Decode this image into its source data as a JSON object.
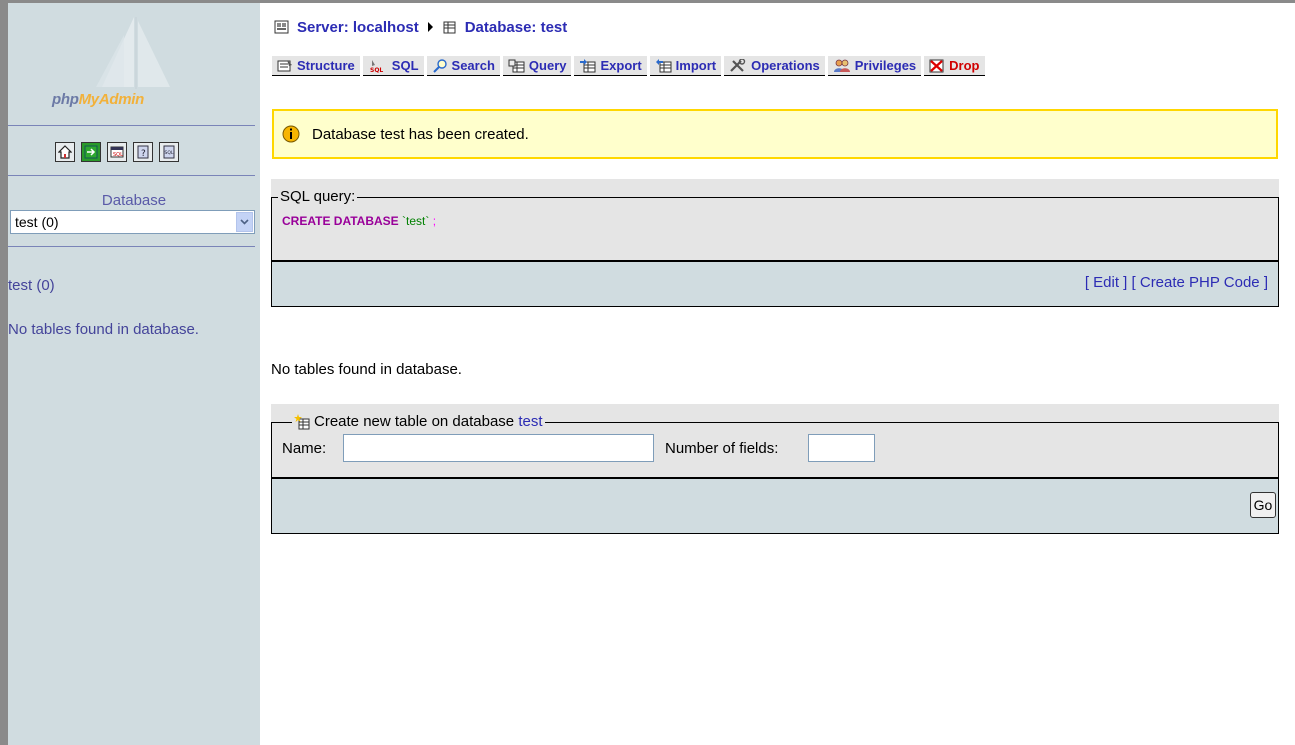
{
  "sidebar": {
    "logo_php": "php",
    "logo_myadmin": "MyAdmin",
    "icons": [
      "home-icon",
      "exit-icon",
      "query-window-icon",
      "documentation-icon",
      "sql-docs-icon"
    ],
    "database_label": "Database",
    "database_selected": "test (0)",
    "db_link": "test (0)",
    "no_tables": "No tables found in database."
  },
  "breadcrumb": {
    "server": "Server: localhost",
    "database": "Database: test"
  },
  "tabs": [
    {
      "label": "Structure",
      "icon": "structure-icon"
    },
    {
      "label": "SQL",
      "icon": "sql-icon"
    },
    {
      "label": "Search",
      "icon": "search-icon"
    },
    {
      "label": "Query",
      "icon": "query-icon"
    },
    {
      "label": "Export",
      "icon": "export-icon"
    },
    {
      "label": "Import",
      "icon": "import-icon"
    },
    {
      "label": "Operations",
      "icon": "operations-icon"
    },
    {
      "label": "Privileges",
      "icon": "privileges-icon"
    },
    {
      "label": "Drop",
      "icon": "drop-icon"
    }
  ],
  "notice": {
    "text": "Database test has been created."
  },
  "sql_box": {
    "legend": "SQL query:",
    "keyword": "CREATE DATABASE",
    "identifier": "`test`",
    "terminator": ";",
    "edit_link": "Edit",
    "php_link": "Create PHP Code"
  },
  "main": {
    "no_tables": "No tables found in database."
  },
  "create_table": {
    "legend_prefix": "Create new table on database",
    "legend_db": "test",
    "name_label": "Name:",
    "name_value": "",
    "fields_label": "Number of fields:",
    "fields_value": "",
    "go_label": "Go"
  },
  "colors": {
    "sidebar_bg": "#d0dce0",
    "link": "#2c2cb4",
    "notice_bg": "#ffffcc",
    "notice_border": "#ffd700",
    "drop": "#d00000"
  }
}
